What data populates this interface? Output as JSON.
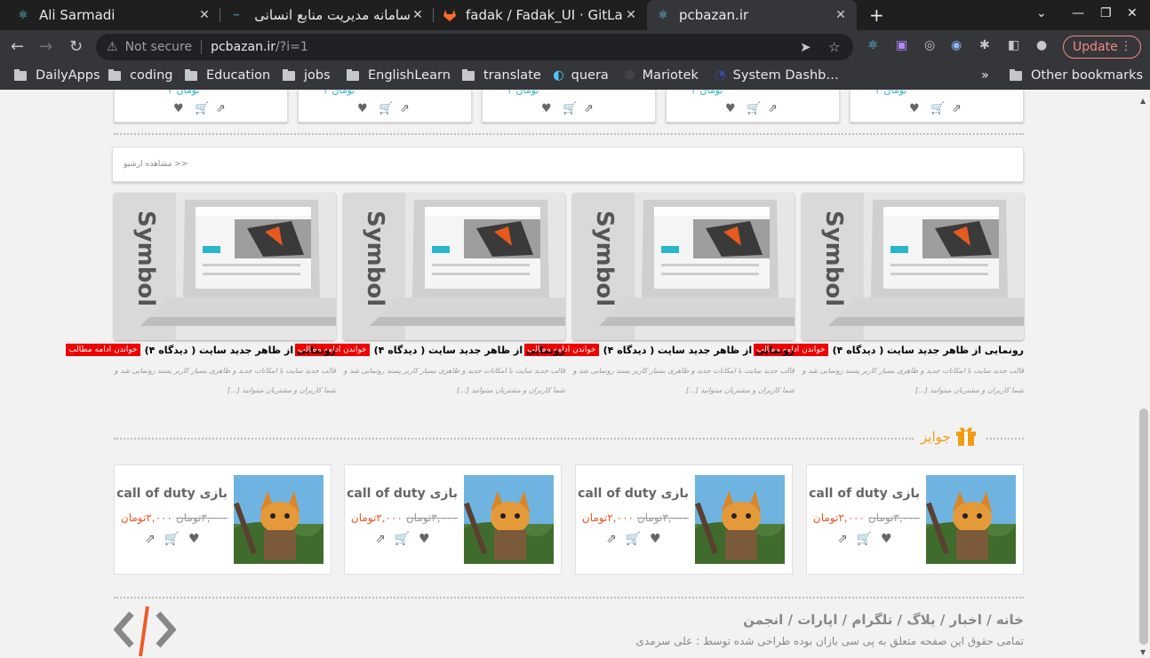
{
  "tabs": [
    {
      "title": "Ali Sarmadi",
      "icon": "react-icon"
    },
    {
      "title": "سامانه مدیریت منابع انسانی",
      "icon": "hrm-icon"
    },
    {
      "title": "fadak / Fadak_UI · GitLab",
      "icon": "gitlab-icon"
    },
    {
      "title": "pcbazan.ir",
      "icon": "react-icon"
    }
  ],
  "toolbar": {
    "security": "Not secure",
    "url_host": "pcbazan.ir",
    "url_path": "/?i=1",
    "update_label": "Update"
  },
  "bookmarks": [
    {
      "label": "DailyApps"
    },
    {
      "label": "coding"
    },
    {
      "label": "Education"
    },
    {
      "label": "jobs"
    },
    {
      "label": "EnglishLearn"
    },
    {
      "label": "translate"
    },
    {
      "label": "quera"
    },
    {
      "label": "Mariotek"
    },
    {
      "label": "System Dashb…"
    }
  ],
  "other_bookmarks": "Other bookmarks",
  "archive_link": "مشاهده ارشیو >>",
  "posts": [
    {
      "title": "رونمایی از ظاهر جدید سایت ( دیدگاه ۴)",
      "more": "خواندن ادامه مطالب",
      "desc": "قالب جدید سایت با امکانات جدید و ظاهری بسیار کاربر پسند رونمایی شد و شما کاربران و مشتریان میتوانید [...]"
    },
    {
      "title": "رونمایی از ظاهر جدید سایت ( دیدگاه ۴)",
      "more": "خواندن ادامه مطالب",
      "desc": "قالب جدید سایت با امکانات جدید و ظاهری بسیار کاربر پسند رونمایی شد و شما کاربران و مشتریان میتوانید [...]"
    },
    {
      "title": "رونمایی از ظاهر جدید سایت ( دیدگاه ۴)",
      "more": "خواندن ادامه مطالب",
      "desc": "قالب جدید سایت با امکانات جدید و ظاهری بسیار کاربر پسند رونمایی شد و شما کاربران و مشتریان میتوانید [...]"
    },
    {
      "title": "رونمایی از ظاهر جدید سایت ( دیدگاه ۴)",
      "more": "خواندن ادامه مطالب",
      "desc": "قالب جدید سایت با امکانات جدید و ظاهری بسیار کاربر پسند رونمایی شد و شما کاربران و مشتریان میتوانید [...]"
    }
  ],
  "gifts_heading": "جوایز",
  "gifts": [
    {
      "name": "بازی call of duty",
      "old_price": "۳,۰۰۰تومان",
      "new_price": "۲,۰۰۰تومان"
    },
    {
      "name": "بازی call of duty",
      "old_price": "۳,۰۰۰تومان",
      "new_price": "۲,۰۰۰تومان"
    },
    {
      "name": "بازی call of duty",
      "old_price": "۳,۰۰۰تومان",
      "new_price": "۲,۰۰۰تومان"
    },
    {
      "name": "بازی call of duty",
      "old_price": "۳,۰۰۰تومان",
      "new_price": "۲,۰۰۰تومان"
    }
  ],
  "footer": {
    "links": "خانه / اخبار / یلاگ / تلگرام / اپارات / انجمن",
    "copyright": "تمامی حقوق این صفحه متعلق به پی سی بازان بوده طراحی شده توسط : علی سرمدی"
  }
}
